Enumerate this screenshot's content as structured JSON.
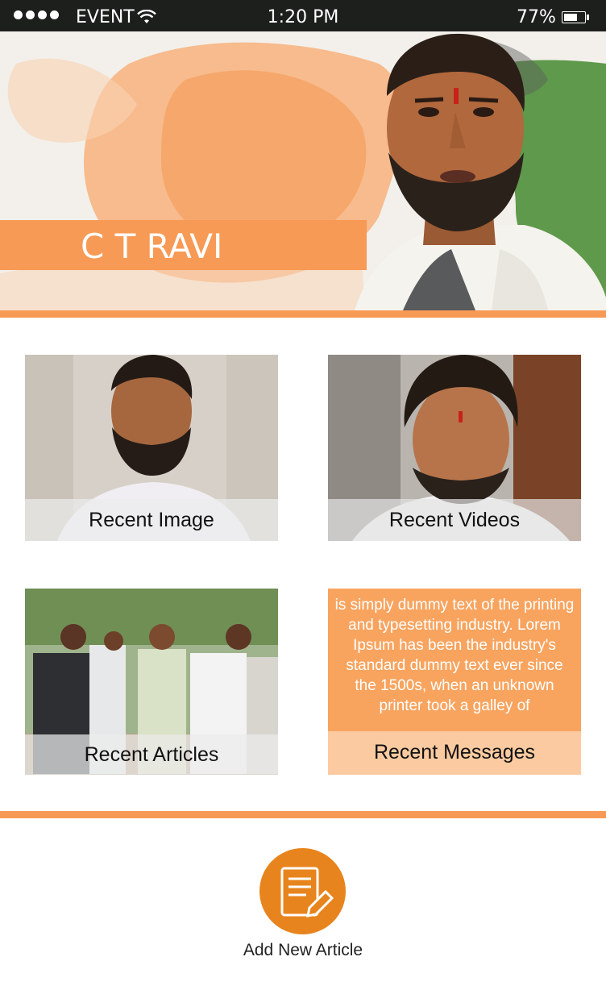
{
  "status_bar": {
    "carrier": "EVENT",
    "time": "1:20 PM",
    "battery_percent": "77%",
    "battery_level": 0.77
  },
  "hero": {
    "name": "C T RAVI"
  },
  "tiles": {
    "recent_image": {
      "label": "Recent Image"
    },
    "recent_videos": {
      "label": "Recent Videos"
    },
    "recent_articles": {
      "label": "Recent Articles"
    },
    "recent_messages": {
      "label": "Recent Messages",
      "preview": "is simply dummy text of the printing and typesetting industry. Lorem Ipsum has been the industry's standard dummy text ever since the 1500s, when an unknown printer took a galley of"
    }
  },
  "add_article": {
    "label": "Add New Article"
  },
  "colors": {
    "accent": "#f79a55",
    "button": "#e8841d",
    "message_bg": "#f8a45f",
    "message_caption_bg": "#fccaa0"
  }
}
